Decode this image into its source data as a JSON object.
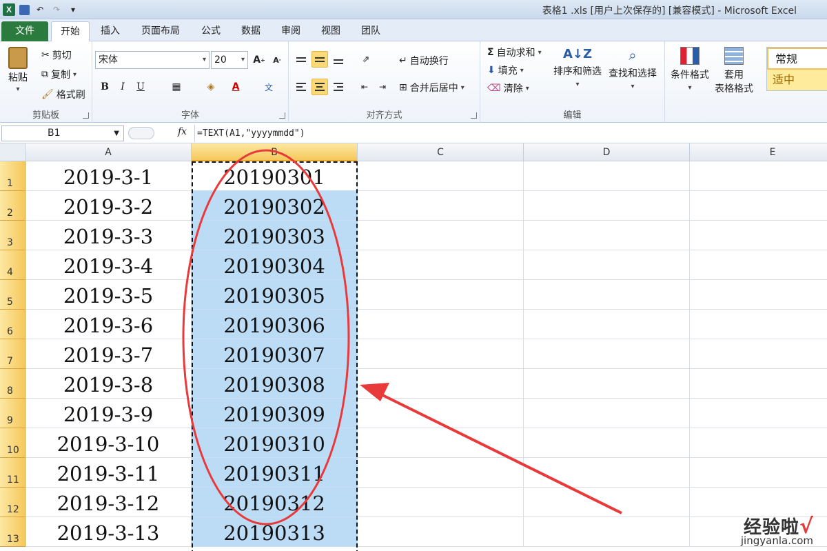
{
  "window": {
    "title": "表格1 .xls  [用户上次保存的]  [兼容模式] - Microsoft Excel"
  },
  "tabs": [
    {
      "label": "文件"
    },
    {
      "label": "开始"
    },
    {
      "label": "插入"
    },
    {
      "label": "页面布局"
    },
    {
      "label": "公式"
    },
    {
      "label": "数据"
    },
    {
      "label": "审阅"
    },
    {
      "label": "视图"
    },
    {
      "label": "团队"
    }
  ],
  "ribbon": {
    "clipboard": {
      "paste": "粘贴",
      "cut": "剪切",
      "copy": "复制",
      "format_painter": "格式刷",
      "label": "剪贴板"
    },
    "font": {
      "name": "宋体",
      "size": "20",
      "label": "字体"
    },
    "alignment": {
      "wrap": "自动换行",
      "merge": "合并后居中",
      "label": "对齐方式"
    },
    "editing": {
      "autosum": "自动求和",
      "fill": "填充",
      "clear": "清除",
      "sort": "排序和筛选",
      "find": "查找和选择",
      "label": "编辑"
    },
    "styles": {
      "conditional": "条件格式",
      "table_line1": "套用",
      "table_line2": "表格格式",
      "normal": "常规",
      "neutral": "适中"
    }
  },
  "formula_bar": {
    "name_box": "B1",
    "fx": "fx",
    "formula": "=TEXT(A1,\"yyyymmdd\")"
  },
  "sheet": {
    "columns": [
      "A",
      "B",
      "C",
      "D",
      "E"
    ],
    "selected_column": "B",
    "rows": [
      {
        "n": "1",
        "a": "2019-3-1",
        "b": "20190301"
      },
      {
        "n": "2",
        "a": "2019-3-2",
        "b": "20190302"
      },
      {
        "n": "3",
        "a": "2019-3-3",
        "b": "20190303"
      },
      {
        "n": "4",
        "a": "2019-3-4",
        "b": "20190304"
      },
      {
        "n": "5",
        "a": "2019-3-5",
        "b": "20190305"
      },
      {
        "n": "6",
        "a": "2019-3-6",
        "b": "20190306"
      },
      {
        "n": "7",
        "a": "2019-3-7",
        "b": "20190307"
      },
      {
        "n": "8",
        "a": "2019-3-8",
        "b": "20190308"
      },
      {
        "n": "9",
        "a": "2019-3-9",
        "b": "20190309"
      },
      {
        "n": "10",
        "a": "2019-3-10",
        "b": "20190310"
      },
      {
        "n": "11",
        "a": "2019-3-11",
        "b": "20190311"
      },
      {
        "n": "12",
        "a": "2019-3-12",
        "b": "20190312"
      },
      {
        "n": "13",
        "a": "2019-3-13",
        "b": "20190313"
      }
    ]
  },
  "annotation": {
    "color": "#e83a3a"
  },
  "watermark": {
    "cn": "经验啦",
    "check": "√",
    "en": "jingyanla.com"
  },
  "colors": {
    "selection": "#bcdcf6",
    "header_selected": "#f6c85c",
    "file_tab": "#2b7a3e"
  }
}
